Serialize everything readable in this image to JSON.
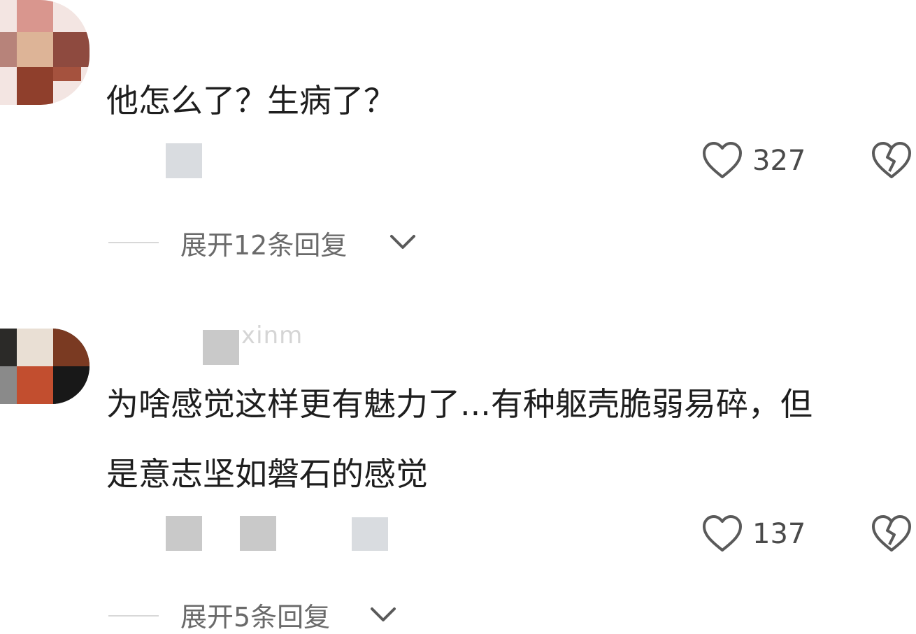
{
  "comments": [
    {
      "text": "他怎么了？生病了？",
      "likes": "327",
      "expand_label": "展开12条回复",
      "like_icon": "heart-outline-icon",
      "dislike_icon": "broken-heart-icon"
    },
    {
      "username": "xinm",
      "text_line1": "为啥感觉这样更有魅力了...有种躯壳脆弱易碎，但",
      "text_line2": "是意志坚如磐石的感觉",
      "likes": "137",
      "expand_label": "展开5条回复",
      "like_icon": "heart-outline-icon",
      "dislike_icon": "broken-heart-icon"
    }
  ],
  "colors": {
    "text": "#1e1e1e",
    "muted": "#6a6a6a",
    "icon": "#5a5a5a",
    "mosaic": "#c9c9c9"
  }
}
